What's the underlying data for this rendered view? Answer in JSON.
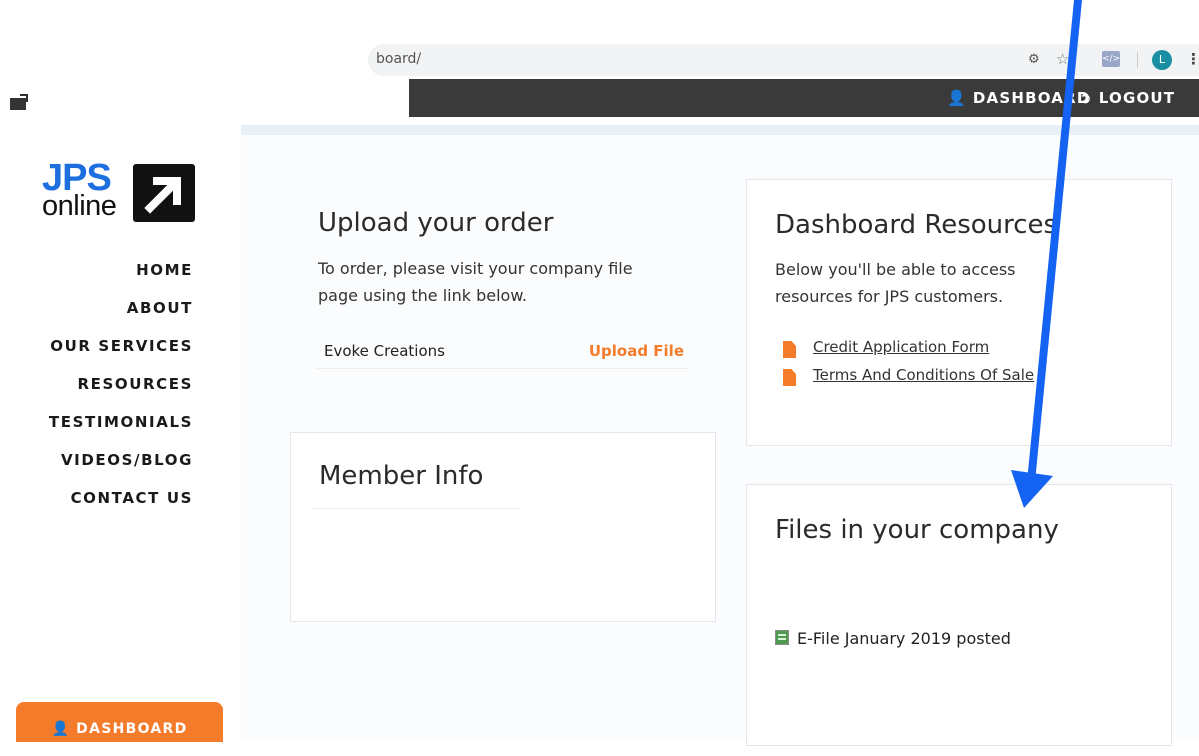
{
  "browser": {
    "url_text": "board/",
    "profile_initial": "L",
    "icons": [
      "extension-icon",
      "star-icon",
      "dev-tools-icon",
      "kebab-menu-icon"
    ]
  },
  "topbar": {
    "dashboard_label": "DASHBOARD",
    "logout_label": "LOGOUT"
  },
  "logo": {
    "brand_top": "JPS",
    "brand_bottom": "online",
    "brand_color": "#1d6fe0"
  },
  "sidebar": {
    "items": [
      {
        "label": "HOME"
      },
      {
        "label": "ABOUT"
      },
      {
        "label": "OUR SERVICES"
      },
      {
        "label": "RESOURCES"
      },
      {
        "label": "TESTIMONIALS"
      },
      {
        "label": "VIDEOS/BLOG"
      },
      {
        "label": "CONTACT US"
      }
    ],
    "dashboard_button": "DASHBOARD"
  },
  "upload": {
    "title": "Upload your order",
    "description": "To order, please visit your company file page using the link below.",
    "company": "Evoke Creations",
    "upload_link": "Upload File"
  },
  "member": {
    "title": "Member Info"
  },
  "resources": {
    "title": "Dashboard Resources",
    "description": "Below you'll be able to access resources for JPS customers.",
    "links": [
      {
        "label": "Credit Application Form"
      },
      {
        "label": "Terms And Conditions Of Sale"
      }
    ]
  },
  "files": {
    "title": "Files in your company",
    "items": [
      {
        "label": "E-File January 2019 posted"
      }
    ]
  },
  "colors": {
    "accent_orange": "#f47b2a",
    "topbar_bg": "#3a3a3a",
    "annotation_arrow": "#1463f3"
  }
}
